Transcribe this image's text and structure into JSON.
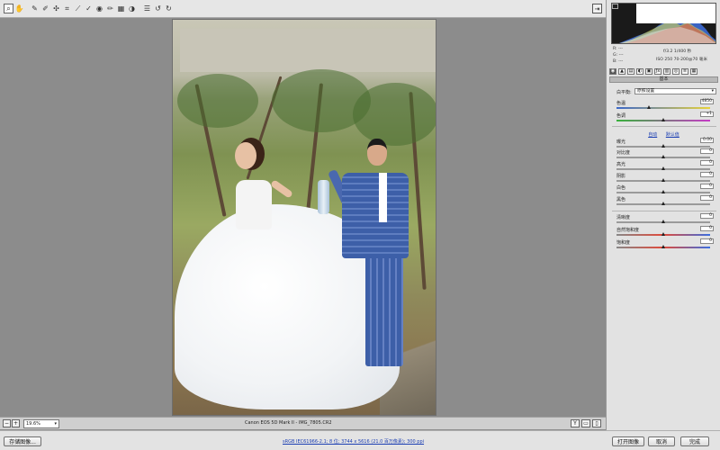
{
  "toolbar": {
    "tools": [
      {
        "name": "zoom-tool-icon",
        "glyph": "⌕",
        "active": true
      },
      {
        "name": "hand-tool-icon",
        "glyph": "✋"
      },
      {
        "name": "white-balance-tool-icon",
        "glyph": "✎"
      },
      {
        "name": "color-sampler-icon",
        "glyph": "✐"
      },
      {
        "name": "targeted-adjustment-icon",
        "glyph": "✣"
      },
      {
        "name": "crop-tool-icon",
        "glyph": "⌗"
      },
      {
        "name": "straighten-tool-icon",
        "glyph": "⟋"
      },
      {
        "name": "spot-removal-icon",
        "glyph": "✓"
      },
      {
        "name": "red-eye-icon",
        "glyph": "◉"
      },
      {
        "name": "adjustment-brush-icon",
        "glyph": "✏"
      },
      {
        "name": "graduated-filter-icon",
        "glyph": "▦"
      },
      {
        "name": "radial-filter-icon",
        "glyph": "◑"
      },
      {
        "name": "preferences-icon",
        "glyph": "☰"
      },
      {
        "name": "rotate-left-icon",
        "glyph": "↺"
      },
      {
        "name": "rotate-right-icon",
        "glyph": "↻"
      }
    ],
    "open_panel_glyph": "⇥"
  },
  "status": {
    "zoom_value": "19.6%",
    "filename_caption": "Canon EOS 5D Mark II -  IMG_7805.CR2",
    "view_toggles": [
      "Y",
      "▭",
      "▯"
    ]
  },
  "footer": {
    "save_label": "存储图像...",
    "workflow_text": "sRGB IEC61966-2.1; 8 位; 3744 x 5616 (21.0 百万像素); 300 ppi",
    "open_label": "打开图像",
    "cancel_label": "取消",
    "done_label": "完成"
  },
  "readout": {
    "r": "R:  ---",
    "g": "G:  ---",
    "b": "B:  ---",
    "exposure": "f/3.2   1/400 秒",
    "iso_lens": "ISO 250   70-200@70 毫米"
  },
  "panel": {
    "title": "基本",
    "tabs": [
      "◉",
      "▲",
      "▤",
      "◐",
      "▣",
      "ƒx",
      "▥",
      "◎",
      "≡",
      "▦"
    ],
    "white_balance_label": "白平衡:",
    "white_balance_value": "原照设置",
    "temperature": {
      "label": "色温",
      "value": "4850",
      "level": 0.35
    },
    "tint": {
      "label": "色调",
      "value": "+1",
      "level": 0.5
    },
    "auto_label": "自动",
    "default_label": "默认值",
    "exposure": {
      "label": "曝光",
      "value": "0.00",
      "level": 0.5
    },
    "contrast": {
      "label": "对比度",
      "value": "0",
      "level": 0.5
    },
    "highlights": {
      "label": "高光",
      "value": "0",
      "level": 0.5
    },
    "shadows": {
      "label": "阴影",
      "value": "0",
      "level": 0.5
    },
    "whites": {
      "label": "白色",
      "value": "0",
      "level": 0.5
    },
    "blacks": {
      "label": "黑色",
      "value": "0",
      "level": 0.5
    },
    "clarity": {
      "label": "清晰度",
      "value": "0",
      "level": 0.5
    },
    "vibrance": {
      "label": "自然饱和度",
      "value": "0",
      "level": 0.5
    },
    "saturation": {
      "label": "饱和度",
      "value": "0",
      "level": 0.5
    }
  },
  "colors": {
    "canvas": "#8c8c8c",
    "panel": "#e2e2e2",
    "link": "#1c3fb3"
  }
}
